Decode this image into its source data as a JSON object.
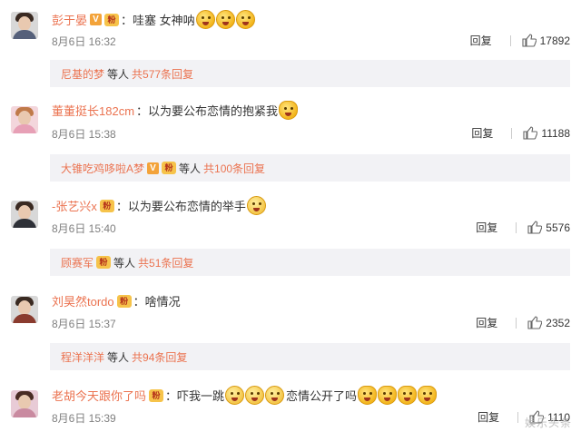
{
  "comments": [
    {
      "username": "彭于晏",
      "text": "：哇塞 女神呐",
      "time": "8月6日 16:32",
      "reply_label": "回复",
      "likes": "17892",
      "replies_from": "尼基的梦",
      "replies_etc": "等人",
      "replies_count": "共577条回复"
    },
    {
      "username": "董董挺长182cm",
      "text": "：以为要公布恋情的抱紧我",
      "time": "8月6日 15:38",
      "reply_label": "回复",
      "likes": "11188",
      "replies_from": "大锥吃鸡哆啦A梦",
      "replies_etc": "等人",
      "replies_count": "共100条回复"
    },
    {
      "username": "-张艺兴x",
      "text": "：以为要公布恋情的举手",
      "time": "8月6日 15:40",
      "reply_label": "回复",
      "likes": "5576",
      "replies_from": "顾赛军",
      "replies_etc": "等人",
      "replies_count": "共51条回复"
    },
    {
      "username": "刘昊然tordo",
      "text": "：啥情况",
      "time": "8月6日 15:37",
      "reply_label": "回复",
      "likes": "2352",
      "replies_from": "程洋洋洋",
      "replies_etc": "等人",
      "replies_count": "共94条回复"
    },
    {
      "username": "老胡今天跟你了吗",
      "text": "：吓我一跳",
      "text2": "恋情公开了吗",
      "time": "8月6日 15:39",
      "reply_label": "回复",
      "likes": "1110"
    }
  ],
  "watermark": "娱乐头条",
  "icons": {
    "thumb": "thumb-up-icon",
    "verified": "verified-badge-icon",
    "medal": "fan-medal-icon",
    "emoji": "emoji-icon"
  },
  "colors": {
    "accent": "#eb7350",
    "subbar_bg": "#f2f2f5",
    "secondary_text": "#808080"
  }
}
